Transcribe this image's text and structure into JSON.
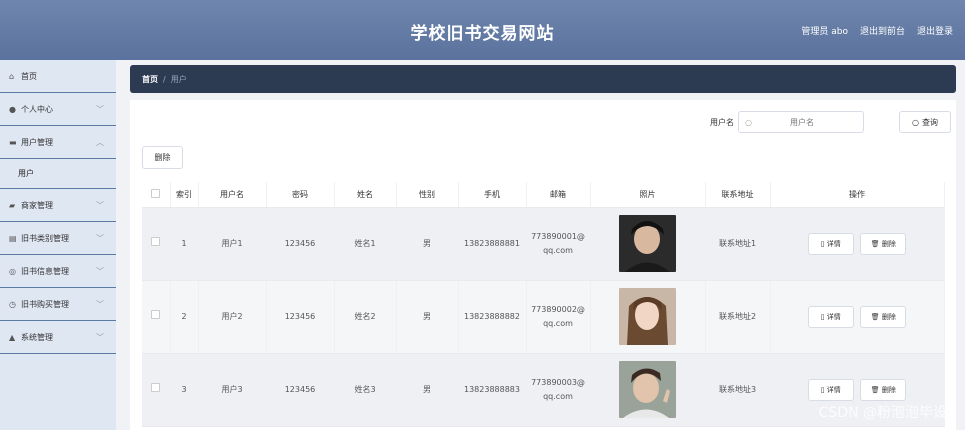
{
  "header": {
    "title": "学校旧书交易网站",
    "admin": "管理员 abo",
    "back": "退出到前台",
    "logout": "退出登录"
  },
  "sidebar": {
    "items": [
      {
        "label": "首页",
        "icon": "home-icon"
      },
      {
        "label": "个人中心",
        "icon": "person-icon"
      },
      {
        "label": "用户管理",
        "icon": "users-icon"
      },
      {
        "label": "商家管理",
        "icon": "shop-icon"
      },
      {
        "label": "旧书类别管理",
        "icon": "list-icon"
      },
      {
        "label": "旧书信息管理",
        "icon": "info-icon"
      },
      {
        "label": "旧书购买管理",
        "icon": "clock-icon"
      },
      {
        "label": "系统管理",
        "icon": "gear-icon"
      }
    ],
    "sub_user": "用户"
  },
  "breadcrumb": {
    "home": "首页",
    "sep": "/",
    "current": "用户"
  },
  "search": {
    "label": "用户名",
    "placeholder": "用户名",
    "button": "查询"
  },
  "delete_button": "删除",
  "table": {
    "headers": [
      "",
      "索引",
      "用户名",
      "密码",
      "姓名",
      "性别",
      "手机",
      "邮箱",
      "照片",
      "联系地址",
      "操作"
    ],
    "rows": [
      {
        "index": "1",
        "username": "用户1",
        "password": "123456",
        "name": "姓名1",
        "gender": "男",
        "phone": "13823888881",
        "email_1": "773890001@",
        "email_2": "qq.com",
        "address": "联系地址1"
      },
      {
        "index": "2",
        "username": "用户2",
        "password": "123456",
        "name": "姓名2",
        "gender": "男",
        "phone": "13823888882",
        "email_1": "773890002@",
        "email_2": "qq.com",
        "address": "联系地址2"
      },
      {
        "index": "3",
        "username": "用户3",
        "password": "123456",
        "name": "姓名3",
        "gender": "男",
        "phone": "13823888883",
        "email_1": "773890003@",
        "email_2": "qq.com",
        "address": "联系地址3"
      }
    ],
    "detail_btn": "详情",
    "delete_btn": "删除"
  },
  "watermark": "CSDN @粉泡泡毕设",
  "colors": {
    "header": "#5f77a1",
    "sidebar": "#dfe7f3",
    "breadcrumb": "#2c3a52"
  }
}
